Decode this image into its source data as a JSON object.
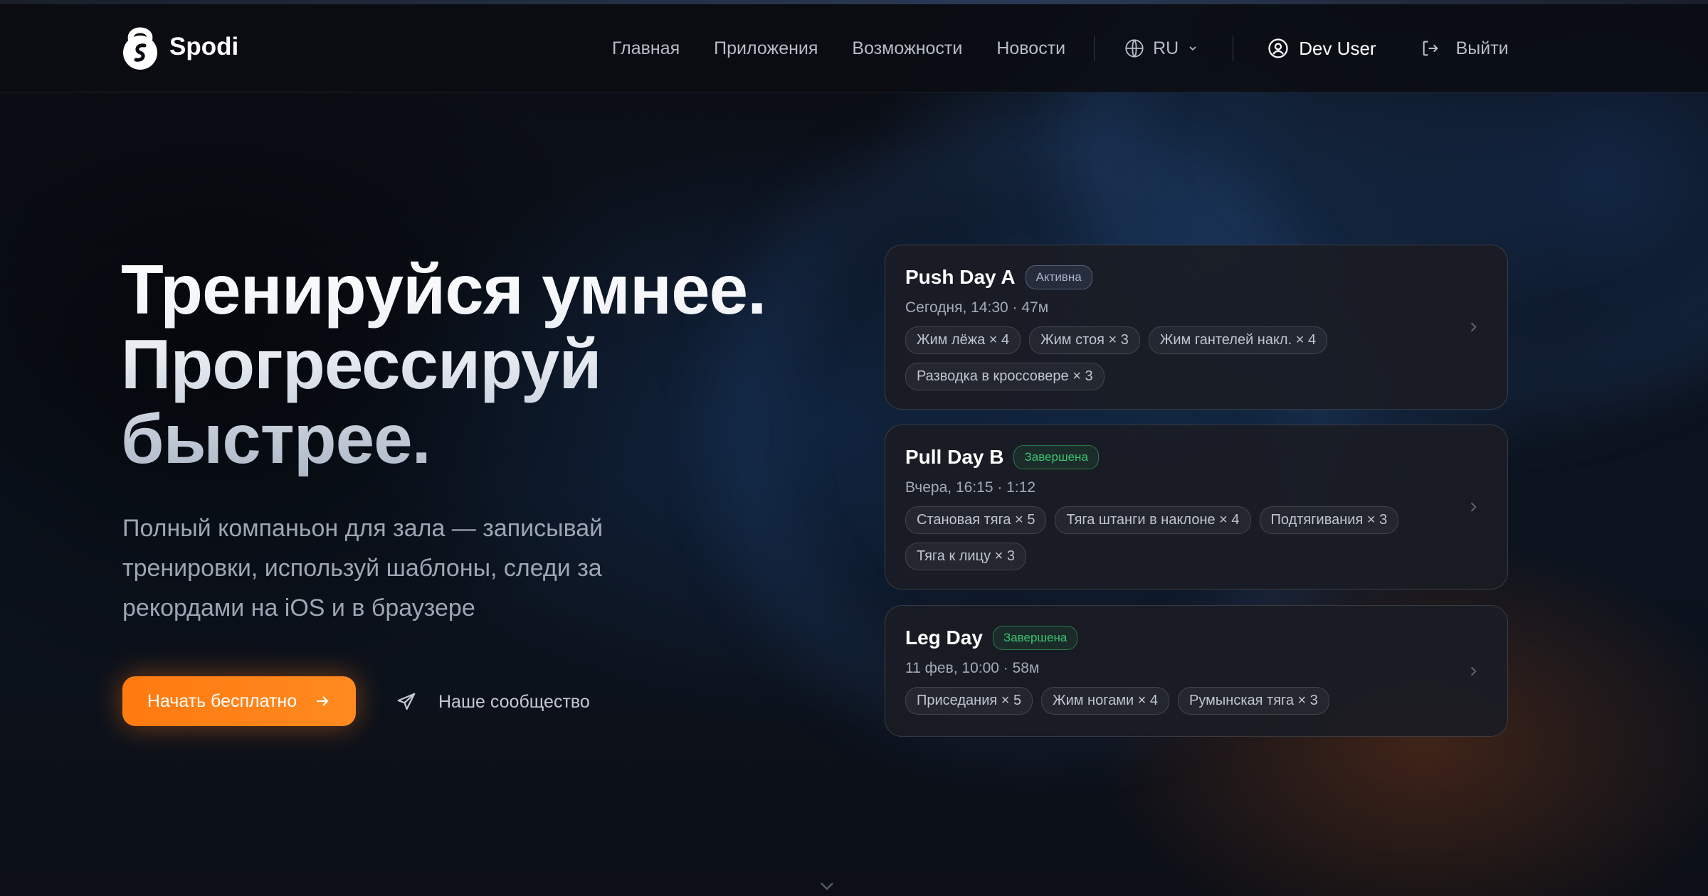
{
  "header": {
    "logo_text": "Spodi",
    "nav": [
      {
        "label": "Главная"
      },
      {
        "label": "Приложения"
      },
      {
        "label": "Возможности"
      },
      {
        "label": "Новости"
      }
    ],
    "language": "RU",
    "user_name": "Dev User",
    "logout_label": "Выйти"
  },
  "hero": {
    "title_lines": [
      "Тренируйся умнее.",
      "Прогрессируй",
      "быстрее."
    ],
    "subtitle": "Полный компаньон для зала — записывай тренировки, используй шаблоны, следи за рекордами на iOS и в браузере",
    "cta_label": "Начать бесплатно",
    "community_label": "Наше сообщество"
  },
  "workouts": [
    {
      "title": "Push Day A",
      "status": "Активна",
      "meta": "Сегодня, 14:30 · 47м",
      "exercises": [
        "Жим лёжа × 4",
        "Жим стоя × 3",
        "Жим гантелей накл. × 4",
        "Разводка в кроссовере × 3"
      ]
    },
    {
      "title": "Pull Day B",
      "status": "Завершена",
      "meta": "Вчера, 16:15 · 1:12",
      "exercises": [
        "Становая тяга × 5",
        "Тяга штанги в наклоне × 4",
        "Подтягивания × 3",
        "Тяга к лицу × 3"
      ]
    },
    {
      "title": "Leg Day",
      "status": "Завершена",
      "meta": "11 фев, 10:00 · 58м",
      "exercises": [
        "Приседания × 5",
        "Жим ногами × 4",
        "Румынская тяга × 3"
      ]
    }
  ],
  "colors": {
    "accent": "#ff7a10",
    "status_done": "#3cc372",
    "status_active": "#a9b4cc",
    "background": "#0a0c12"
  },
  "icons": [
    "kettlebell-logo-icon",
    "globe-icon",
    "chevron-down-icon",
    "user-circle-icon",
    "logout-icon",
    "arrow-right-icon",
    "send-icon",
    "chevron-right-icon"
  ]
}
